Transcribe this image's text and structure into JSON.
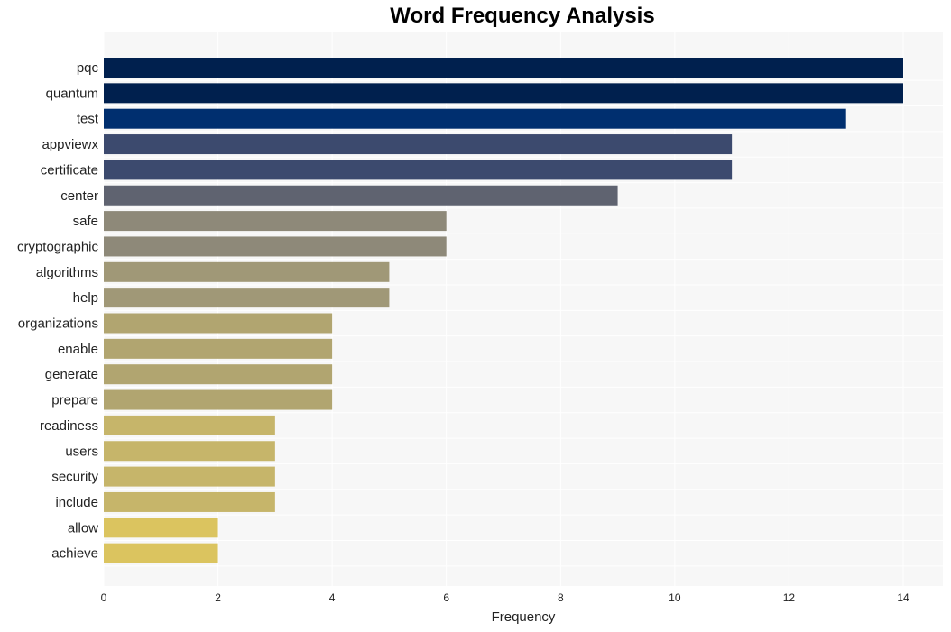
{
  "chart_data": {
    "type": "bar",
    "orientation": "horizontal",
    "title": "Word Frequency Analysis",
    "xlabel": "Frequency",
    "ylabel": "",
    "xlim": [
      0,
      14.7
    ],
    "xticks": [
      0,
      2,
      4,
      6,
      8,
      10,
      12,
      14
    ],
    "grid": true,
    "categories": [
      "pqc",
      "quantum",
      "test",
      "appviewx",
      "certificate",
      "center",
      "safe",
      "cryptographic",
      "algorithms",
      "help",
      "organizations",
      "enable",
      "generate",
      "prepare",
      "readiness",
      "users",
      "security",
      "include",
      "allow",
      "achieve"
    ],
    "values": [
      14,
      14,
      13,
      11,
      11,
      9,
      6,
      6,
      5,
      5,
      4,
      4,
      4,
      4,
      3,
      3,
      3,
      3,
      2,
      2
    ],
    "colors": [
      "#00204e",
      "#00204e",
      "#002f6f",
      "#3c4a6e",
      "#3c4a6e",
      "#5f6370",
      "#8e8979",
      "#8e8979",
      "#a09877",
      "#a09877",
      "#b1a570",
      "#b1a570",
      "#b1a570",
      "#b1a570",
      "#c6b56a",
      "#c6b56a",
      "#c6b56a",
      "#c6b56a",
      "#dbc45f",
      "#dbc45f"
    ],
    "background": "#f7f7f7"
  }
}
